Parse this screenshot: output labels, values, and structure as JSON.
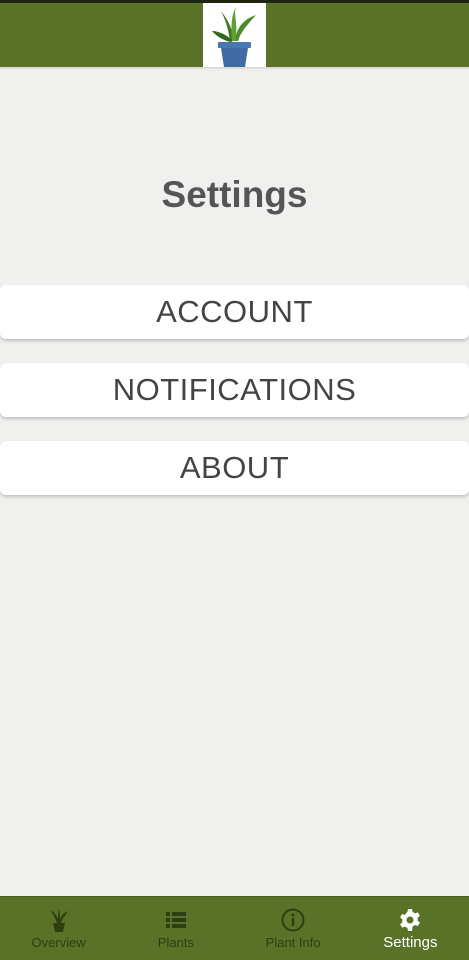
{
  "header": {
    "logo_icon": "potted-plant-logo"
  },
  "page": {
    "title": "Settings"
  },
  "menu": {
    "items": [
      {
        "label": "ACCOUNT"
      },
      {
        "label": "NOTIFICATIONS"
      },
      {
        "label": "ABOUT"
      }
    ]
  },
  "bottom_nav": {
    "items": [
      {
        "label": "Overview",
        "icon": "plant-icon",
        "active": false
      },
      {
        "label": "Plants",
        "icon": "list-icon",
        "active": false
      },
      {
        "label": "Plant Info",
        "icon": "info-icon",
        "active": false
      },
      {
        "label": "Settings",
        "icon": "gear-icon",
        "active": true
      }
    ]
  },
  "colors": {
    "brand_green": "#5a7228",
    "background": "#f0f0ee",
    "nav_inactive": "#2f3d12",
    "nav_active": "#ffffff",
    "pot_blue": "#3f6aa3",
    "leaf_green": "#4d8a2b"
  }
}
